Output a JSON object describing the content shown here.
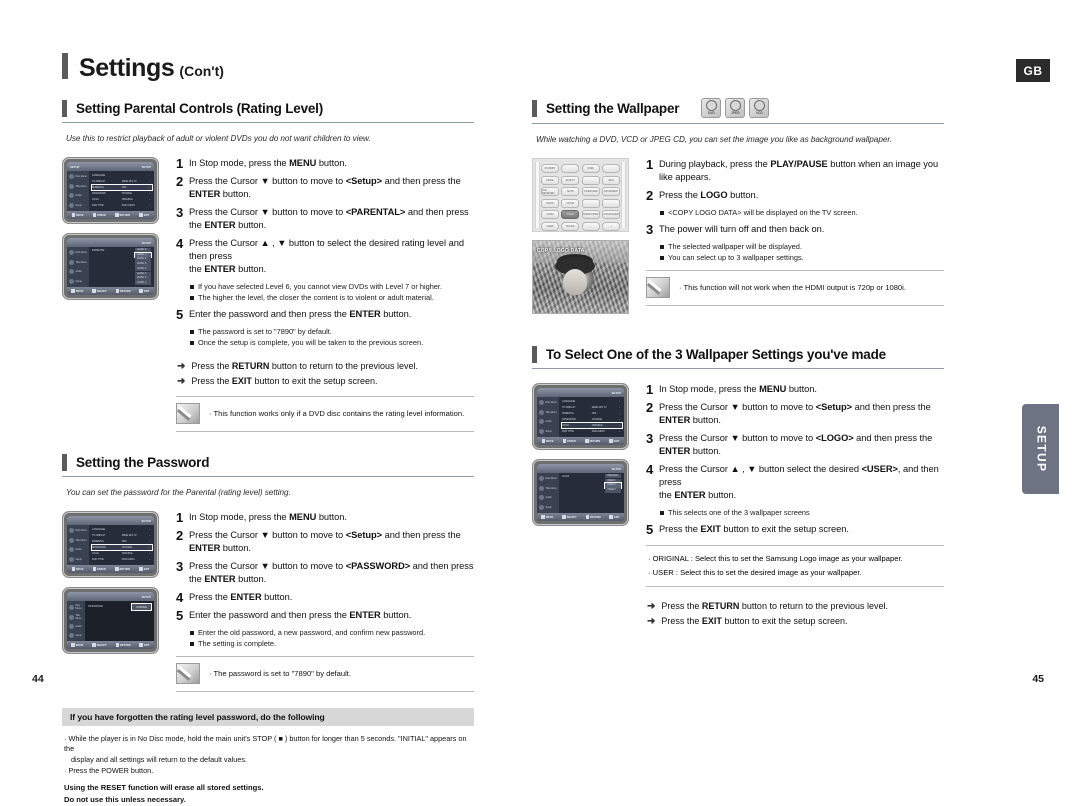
{
  "header": {
    "title": "Settings",
    "subtitle": "(Con't)",
    "region_badge": "GB"
  },
  "side_tab": {
    "label": "SETUP"
  },
  "footer": {
    "page_left": "44",
    "page_right": "45"
  },
  "left_column": {
    "section1": {
      "heading": "Setting Parental Controls (Rating Level)",
      "lead": "Use this to restrict playback of adult or violent DVDs you do not want children to view.",
      "steps": [
        {
          "num": "1",
          "text_parts": [
            {
              "t": "In Stop mode, press the ",
              "b": false
            },
            {
              "t": "MENU",
              "b": true
            },
            {
              "t": " button.",
              "b": false
            }
          ]
        },
        {
          "num": "2",
          "text_parts": [
            {
              "t": "Press the Cursor ",
              "b": false
            },
            {
              "t": "▼",
              "b": false
            },
            {
              "t": " button to move to ",
              "b": false
            },
            {
              "t": "<Setup>",
              "b": true
            },
            {
              "t": " and then press the ",
              "b": false
            },
            {
              "t": "ENTER",
              "b": true
            },
            {
              "t": " button.",
              "b": false
            }
          ]
        },
        {
          "num": "3",
          "text_parts": [
            {
              "t": "Press the Cursor ",
              "b": false
            },
            {
              "t": "▼",
              "b": false
            },
            {
              "t": " button to move to ",
              "b": false
            },
            {
              "t": "<PARENTAL>",
              "b": true
            },
            {
              "t": " and then press",
              "b": false
            },
            {
              "t": "\nthe ",
              "b": false
            },
            {
              "t": "ENTER",
              "b": true
            },
            {
              "t": " button.",
              "b": false
            }
          ]
        },
        {
          "num": "4",
          "text_parts": [
            {
              "t": "Press the Cursor ",
              "b": false
            },
            {
              "t": "▲ , ▼",
              "b": false
            },
            {
              "t": " button to select the desired rating level and then press",
              "b": false
            },
            {
              "t": "\nthe ",
              "b": false
            },
            {
              "t": "ENTER",
              "b": true
            },
            {
              "t": " button.",
              "b": false
            }
          ],
          "bullets": [
            "If you have selected Level 6, you cannot view DVDs with Level 7 or higher.",
            "The higher the level, the closer the content is to violent or adult material."
          ]
        },
        {
          "num": "5",
          "text_parts": [
            {
              "t": "Enter the password and then press the ",
              "b": false
            },
            {
              "t": "ENTER",
              "b": true
            },
            {
              "t": " button.",
              "b": false
            }
          ],
          "bullets": [
            "The password is set to \"7890\" by default.",
            "Once the setup is complete, you will be taken to the previous screen."
          ]
        }
      ],
      "arrow_notes": [
        [
          {
            "t": "Press the ",
            "b": false
          },
          {
            "t": "RETURN",
            "b": true
          },
          {
            "t": " button to return to the previous level.",
            "b": false
          }
        ],
        [
          {
            "t": "Press the ",
            "b": false
          },
          {
            "t": "EXIT",
            "b": true
          },
          {
            "t": " button to exit the setup screen.",
            "b": false
          }
        ]
      ],
      "memo": "· This function works only if a DVD disc contains the rating level information."
    },
    "section2": {
      "heading": "Setting the Password",
      "lead": "You can set the password for the Parental (rating level) setting.",
      "steps": [
        {
          "num": "1",
          "text_parts": [
            {
              "t": "In Stop mode, press the ",
              "b": false
            },
            {
              "t": "MENU",
              "b": true
            },
            {
              "t": " button.",
              "b": false
            }
          ]
        },
        {
          "num": "2",
          "text_parts": [
            {
              "t": "Press the Cursor ",
              "b": false
            },
            {
              "t": "▼",
              "b": false
            },
            {
              "t": " button to move to ",
              "b": false
            },
            {
              "t": "<Setup>",
              "b": true
            },
            {
              "t": " and then press the ",
              "b": false
            },
            {
              "t": "ENTER",
              "b": true
            },
            {
              "t": " button.",
              "b": false
            }
          ]
        },
        {
          "num": "3",
          "text_parts": [
            {
              "t": "Press the Cursor ",
              "b": false
            },
            {
              "t": "▼",
              "b": false
            },
            {
              "t": " button to move to ",
              "b": false
            },
            {
              "t": "<PASSWORD>",
              "b": true
            },
            {
              "t": " and then press",
              "b": false
            },
            {
              "t": "\nthe ",
              "b": false
            },
            {
              "t": "ENTER",
              "b": true
            },
            {
              "t": " button.",
              "b": false
            }
          ]
        },
        {
          "num": "4",
          "text_parts": [
            {
              "t": "Press the ",
              "b": false
            },
            {
              "t": "ENTER",
              "b": true
            },
            {
              "t": " button.",
              "b": false
            }
          ]
        },
        {
          "num": "5",
          "text_parts": [
            {
              "t": "Enter the password and then press the ",
              "b": false
            },
            {
              "t": "ENTER",
              "b": true
            },
            {
              "t": " button.",
              "b": false
            }
          ],
          "bullets": [
            "Enter the old password, a new password, and confirm new password.",
            "The setting is complete."
          ]
        }
      ],
      "memo": "· The password is set to \"7890\" by default."
    },
    "band": {
      "heading": "If you have forgotten the rating level password, do the following",
      "lines": [
        "· While the player is in No Disc mode, hold the main unit's STOP ( ■ ) button for longer than 5 seconds. \"INITIAL\" appears on  the",
        "display and all settings will return to the default values.",
        "· Press the POWER button."
      ],
      "strong_lines": [
        "Using the RESET function will erase all stored settings.",
        "Do not use this unless necessary."
      ]
    }
  },
  "right_column": {
    "section1": {
      "heading": "Setting the Wallpaper",
      "disc_icons": [
        "DVD",
        "JPEG",
        "VCD"
      ],
      "lead": "While watching a DVD, VCD or JPEG CD, you can set the image you like as background wallpaper.",
      "steps": [
        {
          "num": "1",
          "text_parts": [
            {
              "t": "During playback, press the ",
              "b": false
            },
            {
              "t": "PLAY/PAUSE",
              "b": true
            },
            {
              "t": " button when an image you like appears.",
              "b": false
            }
          ]
        },
        {
          "num": "2",
          "text_parts": [
            {
              "t": "Press the ",
              "b": false
            },
            {
              "t": "LOGO",
              "b": true
            },
            {
              "t": " button.",
              "b": false
            }
          ],
          "bullets": [
            "<COPY LOGO DATA> will be displayed on the TV screen."
          ]
        },
        {
          "num": "3",
          "text_parts": [
            {
              "t": "The power will turn off and then back on.",
              "b": false
            }
          ],
          "bullets": [
            "The selected wallpaper will be displayed.",
            "You can select up to 3 wallpaper settings."
          ]
        }
      ],
      "memo": "· This function will not work when the HDMI output is 720p or 1080i.",
      "photo_overlay": "COPY LOGO DATA"
    },
    "section2": {
      "heading": "To Select One of the 3 Wallpaper Settings you've made",
      "steps": [
        {
          "num": "1",
          "text_parts": [
            {
              "t": "In Stop mode, press the ",
              "b": false
            },
            {
              "t": "MENU",
              "b": true
            },
            {
              "t": " button.",
              "b": false
            }
          ]
        },
        {
          "num": "2",
          "text_parts": [
            {
              "t": "Press the Cursor ",
              "b": false
            },
            {
              "t": "▼",
              "b": false
            },
            {
              "t": " button to move to ",
              "b": false
            },
            {
              "t": "<Setup>",
              "b": true
            },
            {
              "t": " and then press the ",
              "b": false
            },
            {
              "t": "ENTER",
              "b": true
            },
            {
              "t": " button.",
              "b": false
            }
          ]
        },
        {
          "num": "3",
          "text_parts": [
            {
              "t": "Press the Cursor ",
              "b": false
            },
            {
              "t": "▼",
              "b": false
            },
            {
              "t": " button to move to ",
              "b": false
            },
            {
              "t": "<LOGO>",
              "b": true
            },
            {
              "t": " and then press the ",
              "b": false
            },
            {
              "t": "ENTER",
              "b": true
            },
            {
              "t": " button.",
              "b": false
            }
          ]
        },
        {
          "num": "4",
          "text_parts": [
            {
              "t": "Press the Cursor ",
              "b": false
            },
            {
              "t": "▲ , ▼",
              "b": false
            },
            {
              "t": " button select the desired ",
              "b": false
            },
            {
              "t": "<USER>",
              "b": true
            },
            {
              "t": ", and then press",
              "b": false
            },
            {
              "t": "\nthe ",
              "b": false
            },
            {
              "t": "ENTER",
              "b": true
            },
            {
              "t": " button.",
              "b": false
            }
          ],
          "bullets": [
            "This selects one of the 3 wallpaper screens"
          ]
        },
        {
          "num": "5",
          "text_parts": [
            {
              "t": "Press the ",
              "b": false
            },
            {
              "t": "EXIT",
              "b": true
            },
            {
              "t": " button to exit the setup screen.",
              "b": false
            }
          ]
        }
      ],
      "notes": [
        "· ORIGINAL : Select this to set the Samsung Logo image as your wallpaper.",
        "· USER : Select this to set the desired image as your wallpaper."
      ],
      "arrow_notes": [
        [
          {
            "t": "Press the ",
            "b": false
          },
          {
            "t": "RETURN",
            "b": true
          },
          {
            "t": " button to return to the previous level.",
            "b": false
          }
        ],
        [
          {
            "t": "Press the ",
            "b": false
          },
          {
            "t": "EXIT",
            "b": true
          },
          {
            "t": " button to exit the setup screen.",
            "b": false
          }
        ]
      ]
    }
  },
  "osd_screens": {
    "setup_main_parental": {
      "title_left": "SETUP",
      "title_right": "SETUP",
      "side_items": [
        "Disc Menu",
        "Title Menu",
        "Audio",
        "Setup"
      ],
      "rows": [
        {
          "label": "LANGUAGE",
          "value": "",
          "selected": false
        },
        {
          "label": "TV DISPLAY",
          "value": "WIDE 16:9 TV",
          "selected": false
        },
        {
          "label": "PARENTAL",
          "value": "OFF",
          "selected": true
        },
        {
          "label": "PASSWORD",
          "value": "CHANGE",
          "selected": false
        },
        {
          "label": "LOGO",
          "value": "ORIGINAL",
          "selected": false
        },
        {
          "label": "DVD TYPE",
          "value": "DVD AUDIO",
          "selected": false
        }
      ],
      "footer": [
        "MOVE",
        "ENTER",
        "RETURN",
        "EXIT"
      ]
    },
    "parental_levels": {
      "title_right": "SETUP",
      "label": "PARENTAL",
      "options": [
        "LEVEL 8",
        "LEVEL 7",
        "LEVEL 6",
        "LEVEL 5",
        "LEVEL 4",
        "LEVEL 3",
        "LEVEL 2",
        "LEVEL 1"
      ],
      "selected_index": 1,
      "footer": [
        "MOVE",
        "SELECT",
        "RETURN",
        "EXIT"
      ]
    },
    "setup_main_password": {
      "title_right": "SETUP",
      "rows": [
        {
          "label": "LANGUAGE",
          "value": "",
          "selected": false
        },
        {
          "label": "TV DISPLAY",
          "value": "WIDE 16:9 TV",
          "selected": false
        },
        {
          "label": "PARENTAL",
          "value": "OFF",
          "selected": false
        },
        {
          "label": "PASSWORD",
          "value": "CHANGE",
          "selected": true
        },
        {
          "label": "LOGO",
          "value": "ORIGINAL",
          "selected": false
        },
        {
          "label": "DVD TYPE",
          "value": "DVD AUDIO",
          "selected": false
        }
      ],
      "footer": [
        "MOVE",
        "ENTER",
        "RETURN",
        "EXIT"
      ]
    },
    "password_entry": {
      "title_right": "SETUP",
      "label": "PASSWORD",
      "value": "CHANGE",
      "footer": [
        "MOVE",
        "SELECT",
        "RETURN",
        "EXIT"
      ]
    },
    "setup_main_logo": {
      "title_right": "SETUP",
      "rows": [
        {
          "label": "LANGUAGE",
          "value": "",
          "selected": false
        },
        {
          "label": "TV DISPLAY",
          "value": "WIDE 16:9 TV",
          "selected": false
        },
        {
          "label": "PARENTAL",
          "value": "OFF",
          "selected": false
        },
        {
          "label": "PASSWORD",
          "value": "CHANGE",
          "selected": false
        },
        {
          "label": "LOGO",
          "value": "ORIGINAL",
          "selected": true
        },
        {
          "label": "DVD TYPE",
          "value": "DVD AUDIO",
          "selected": false
        }
      ],
      "footer": [
        "MOVE",
        "ENTER",
        "RETURN",
        "EXIT"
      ]
    },
    "logo_options": {
      "title_right": "SETUP",
      "label": "LOGO",
      "options": [
        "ORIGINAL",
        "USER 1",
        "USER 2",
        "USER 3"
      ],
      "selected_index": 2,
      "footer": [
        "MOVE",
        "SELECT",
        "RETURN",
        "EXIT"
      ]
    }
  },
  "remote_keys": [
    [
      "STANDBY",
      "",
      "OPEN",
      ""
    ],
    [
      "MODE",
      "EFFECT",
      "",
      "INFO"
    ],
    [
      "DVD RECEIVER",
      "SLOW",
      "TUNER MEM",
      "SOUND/EDIT"
    ],
    [
      "MONO",
      "MOVIE",
      "",
      ""
    ],
    [
      "ZOOM",
      "LOGO",
      "SUBWOOFER",
      "CROSSOVER"
    ],
    [
      "SLEEP",
      "SOUND",
      "MIC VOL",
      ""
    ]
  ]
}
